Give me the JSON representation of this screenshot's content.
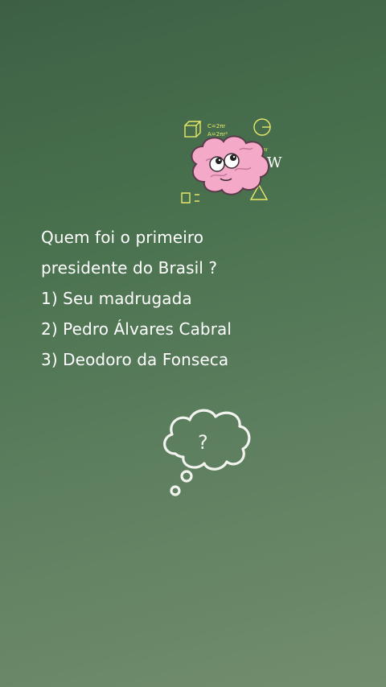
{
  "question": {
    "line1": "Quem foi o primeiro",
    "line2": "presidente do Brasil ?"
  },
  "options": [
    "1) Seu madrugada",
    "2) Pedro Álvares Cabral",
    "3) Deodoro da Fonseca"
  ],
  "sticker": {
    "formula_top": "C=2πr",
    "formula_mid": "A=2πr²",
    "formula_right": "C=2πr",
    "letter": "W",
    "icon": "brain-icon"
  },
  "cloud": {
    "symbol": "?",
    "icon": "question-thought-cloud-icon"
  },
  "colors": {
    "text": "#ffffff",
    "brain_pink": "#f4a9c8",
    "brain_outline": "#5a3b4a",
    "formula_yellow": "#e8e86a"
  }
}
